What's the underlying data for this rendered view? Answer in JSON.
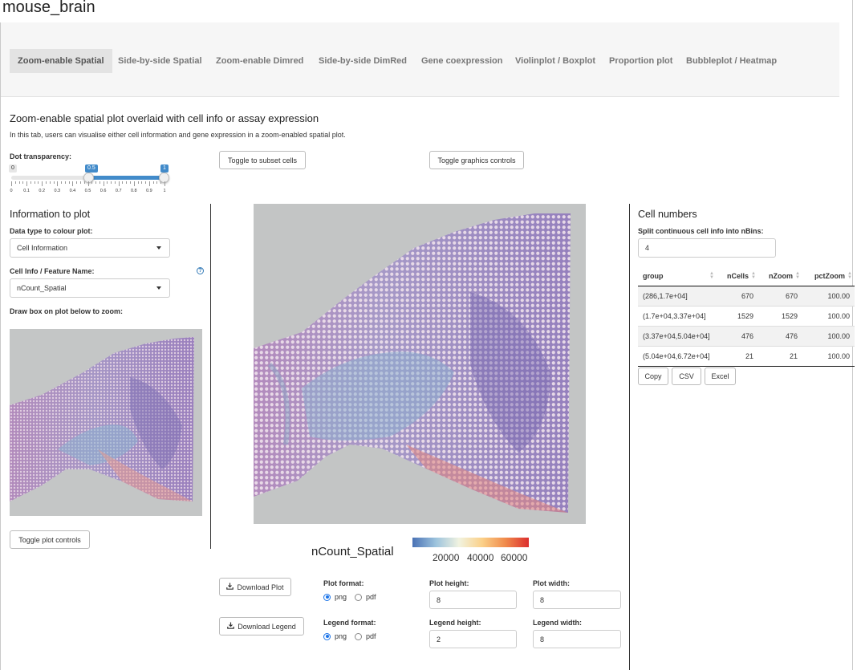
{
  "app": {
    "title": "mouse_brain"
  },
  "tabs": [
    {
      "label": "Zoom-enable Spatial",
      "active": true
    },
    {
      "label": "Side-by-side Spatial"
    },
    {
      "label": "Zoom-enable Dimred"
    },
    {
      "label": "Side-by-side DimRed"
    },
    {
      "label": "Gene coexpression"
    },
    {
      "label": "Violinplot / Boxplot"
    },
    {
      "label": "Proportion plot"
    },
    {
      "label": "Bubbleplot / Heatmap"
    }
  ],
  "intro": {
    "title": "Zoom-enable spatial plot overlaid with cell info or assay expression",
    "desc": "In this tab, users can visualise either cell information and gene expression in a zoom-enabled spatial plot."
  },
  "slider": {
    "label": "Dot transparency:",
    "min_label": "0",
    "low_label": "0.5",
    "high_label": "1",
    "low": 0.5,
    "high": 1,
    "ticks": [
      "0",
      "0.1",
      "0.2",
      "0.3",
      "0.4",
      "0.5",
      "0.6",
      "0.7",
      "0.8",
      "0.9",
      "1"
    ]
  },
  "buttons": {
    "subset": "Toggle to subset cells",
    "graphics": "Toggle graphics controls",
    "plot_controls": "Toggle plot controls",
    "download_plot": "Download Plot",
    "download_legend": "Download Legend"
  },
  "info": {
    "title": "Information to plot",
    "data_type_label": "Data type to colour plot:",
    "data_type_value": "Cell Information",
    "feature_label": "Cell Info / Feature Name:",
    "feature_value": "nCount_Spatial",
    "zoom_label": "Draw box on plot below to zoom:",
    "help_icon": "question-circle-icon"
  },
  "legend": {
    "title": "nCount_Spatial",
    "ticks": [
      "20000",
      "40000",
      "60000"
    ],
    "colors": [
      "#4a72b5",
      "#9cc3dd",
      "#f1f3e0",
      "#fbd088",
      "#f08a4b",
      "#dc2f2f"
    ]
  },
  "export": {
    "plot_format_label": "Plot format:",
    "legend_format_label": "Legend format:",
    "formats": [
      "png",
      "pdf"
    ],
    "selected_format": "png",
    "plot_height_label": "Plot height:",
    "plot_height": "8",
    "plot_width_label": "Plot width:",
    "plot_width": "8",
    "legend_height_label": "Legend height:",
    "legend_height": "2",
    "legend_width_label": "Legend width:",
    "legend_width": "8",
    "download_icon": "download-icon"
  },
  "cells": {
    "title": "Cell numbers",
    "nbins_label": "Split continuous cell info into nBins:",
    "nbins_value": "4",
    "columns": [
      "group",
      "nCells",
      "nZoom",
      "pctZoom"
    ],
    "rows": [
      [
        "(286,1.7e+04]",
        "670",
        "670",
        "100.00"
      ],
      [
        "(1.7e+04,3.37e+04]",
        "1529",
        "1529",
        "100.00"
      ],
      [
        "(3.37e+04,5.04e+04]",
        "476",
        "476",
        "100.00"
      ],
      [
        "(5.04e+04,6.72e+04]",
        "21",
        "21",
        "100.00"
      ]
    ],
    "buttons": [
      "Copy",
      "CSV",
      "Excel"
    ]
  }
}
